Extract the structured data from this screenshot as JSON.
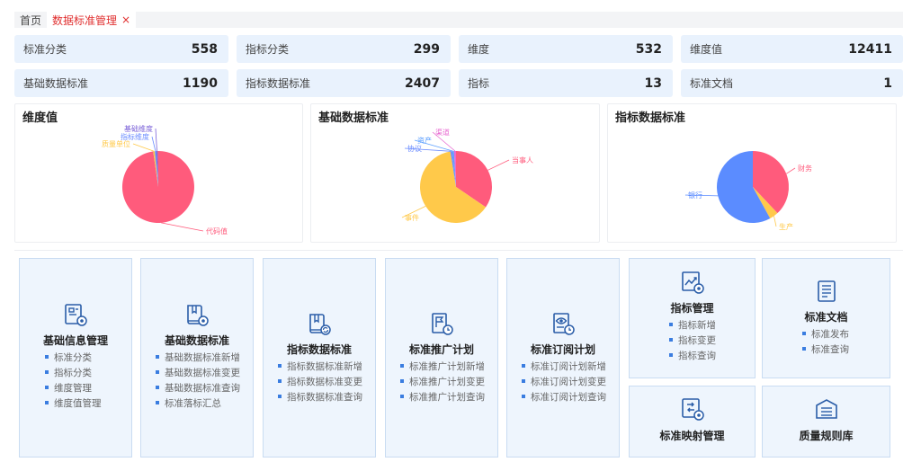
{
  "tabs": [
    {
      "label": "首页",
      "active": false
    },
    {
      "label": "数据标准管理",
      "active": true,
      "close": "×"
    }
  ],
  "stats": [
    {
      "label": "标准分类",
      "value": "558"
    },
    {
      "label": "指标分类",
      "value": "299"
    },
    {
      "label": "维度",
      "value": "532"
    },
    {
      "label": "维度值",
      "value": "12411"
    },
    {
      "label": "基础数据标准",
      "value": "1190"
    },
    {
      "label": "指标数据标准",
      "value": "2407"
    },
    {
      "label": "指标",
      "value": "13"
    },
    {
      "label": "标准文档",
      "value": "1"
    }
  ],
  "chart_data": [
    {
      "type": "pie",
      "title": "维度值",
      "slices": [
        {
          "name": "代码值",
          "value": 98.0,
          "color": "#ff5b7c"
        },
        {
          "name": "质量单位",
          "value": 0.7,
          "color": "#ffc94a"
        },
        {
          "name": "指标维度",
          "value": 0.7,
          "color": "#6b8cff"
        },
        {
          "name": "基础维度",
          "value": 0.6,
          "color": "#7b62d8"
        }
      ]
    },
    {
      "type": "pie",
      "title": "基础数据标准",
      "slices": [
        {
          "name": "当事人",
          "value": 34.5,
          "color": "#ff5b7c"
        },
        {
          "name": "事件",
          "value": 63.0,
          "color": "#ffc94a"
        },
        {
          "name": "协议",
          "value": 0.8,
          "color": "#6b8cff"
        },
        {
          "name": "资产",
          "value": 0.8,
          "color": "#5ea0ff"
        },
        {
          "name": "渠道",
          "value": 0.9,
          "color": "#e86bd2"
        }
      ]
    },
    {
      "type": "pie",
      "title": "指标数据标准",
      "slices": [
        {
          "name": "财务",
          "value": 38.0,
          "color": "#ff5b7c"
        },
        {
          "name": "生产",
          "value": 4.0,
          "color": "#ffc94a"
        },
        {
          "name": "银行",
          "value": 58.0,
          "color": "#5b8cff"
        }
      ]
    }
  ],
  "cards": [
    {
      "title": "基础信息管理",
      "items": [
        "标准分类",
        "指标分类",
        "维度管理",
        "维度值管理"
      ],
      "icon": "info-card-gear-icon"
    },
    {
      "title": "基础数据标准",
      "items": [
        "基础数据标准新增",
        "基础数据标准变更",
        "基础数据标准查询",
        "标准落标汇总"
      ],
      "icon": "book-gear-icon"
    },
    {
      "title": "指标数据标准",
      "items": [
        "指标数据标准新增",
        "指标数据标准变更",
        "指标数据标准查询"
      ],
      "icon": "book-refresh-icon"
    },
    {
      "title": "标准推广计划",
      "items": [
        "标准推广计划新增",
        "标准推广计划变更",
        "标准推广计划查询"
      ],
      "icon": "flag-clock-icon"
    },
    {
      "title": "标准订阅计划",
      "items": [
        "标准订阅计划新增",
        "标准订阅计划变更",
        "标准订阅计划查询"
      ],
      "icon": "eye-clock-icon"
    },
    {
      "title": "指标管理",
      "items": [
        "指标新增",
        "指标变更",
        "指标查询"
      ],
      "icon": "trend-gear-icon"
    },
    {
      "title": "标准文档",
      "items": [
        "标准发布",
        "标准查询"
      ],
      "icon": "document-icon"
    },
    {
      "title": "标准映射管理",
      "items": [],
      "icon": "mapping-gear-icon"
    },
    {
      "title": "质量规则库",
      "items": [],
      "icon": "rule-library-icon"
    }
  ]
}
